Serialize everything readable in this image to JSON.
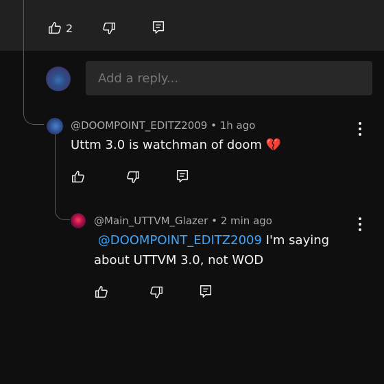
{
  "parent_actions": {
    "like_count": "2"
  },
  "reply_box": {
    "placeholder": "Add a reply..."
  },
  "comments": [
    {
      "author": "@DOOMPOINT_EDITZ2009",
      "separator": " • ",
      "time": "1h ago",
      "text": "Uttm 3.0 is watchman of doom",
      "emoji": "💔"
    },
    {
      "author": "@Main_UTTVM_Glazer",
      "separator": " • ",
      "time": "2 min ago",
      "mention": "@DOOMPOINT_EDITZ2009",
      "text": " I'm saying about UTTVM 3.0, not WOD"
    }
  ],
  "icons": {
    "like": "thumbs-up-icon",
    "dislike": "thumbs-down-icon",
    "reply": "reply-comment-icon",
    "more": "more-vertical-icon"
  },
  "colors": {
    "background": "#0f0f0f",
    "top_bar": "#212121",
    "input_bg": "#282828",
    "mention": "#3ea6ff",
    "meta_text": "#aaaaaa"
  }
}
